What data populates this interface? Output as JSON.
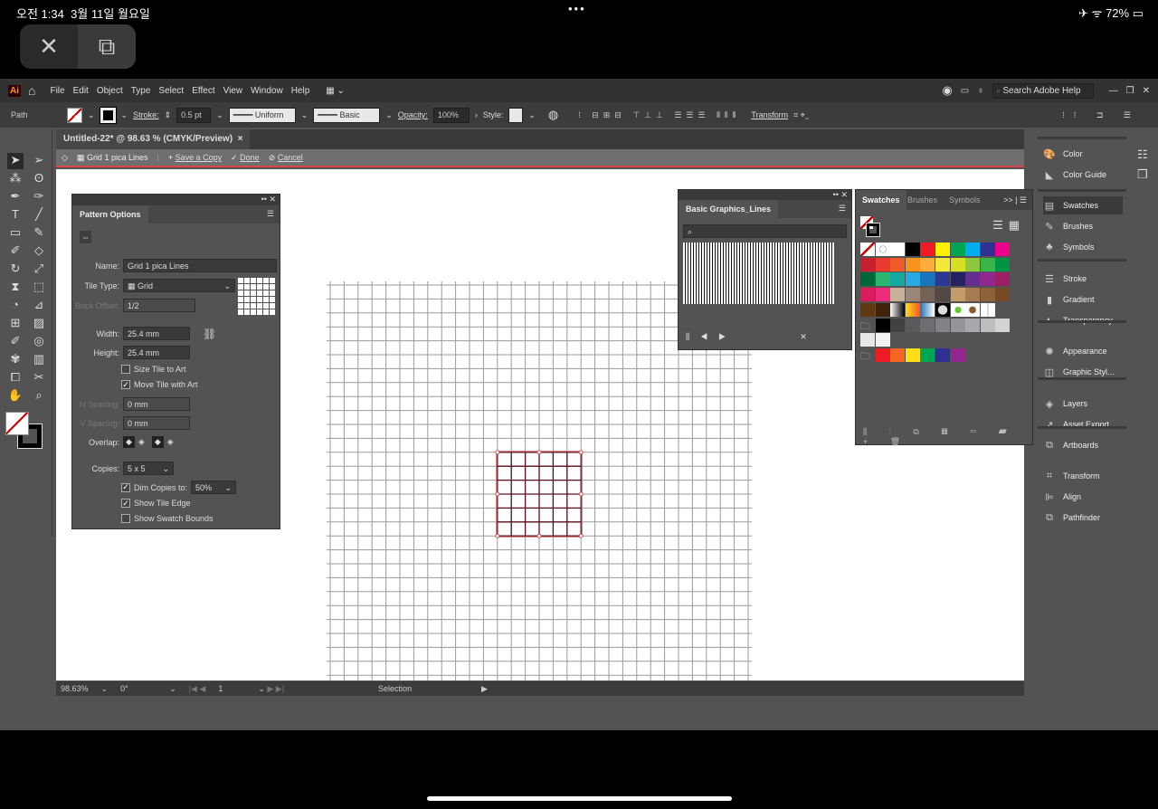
{
  "device": {
    "time": "오전 1:34",
    "date": "3월 11일 월요일",
    "dots": "•••",
    "battery": "72%",
    "icons": [
      "airplane-icon",
      "wifi-icon",
      "battery-icon"
    ]
  },
  "overlay": {
    "close": "✕",
    "pip": "⧉"
  },
  "menu": [
    "File",
    "Edit",
    "Object",
    "Type",
    "Select",
    "Effect",
    "View",
    "Window",
    "Help"
  ],
  "search_placeholder": "Search Adobe Help",
  "control": {
    "selection": "Path",
    "stroke_label": "Stroke:",
    "stroke_value": "0.5 pt",
    "profile": "Uniform",
    "brush": "Basic",
    "opacity_label": "Opacity:",
    "opacity_value": "100%",
    "style_label": "Style:",
    "transform": "Transform"
  },
  "document_tab": {
    "title": "Untitled-22* @ 98.63 % (CMYK/Preview)",
    "close": "×"
  },
  "pattern_bar": {
    "name": "Grid 1 pica Lines",
    "save": "Save a Copy",
    "done": "Done",
    "cancel": "Cancel"
  },
  "pattern_options": {
    "title": "Pattern Options",
    "name_label": "Name:",
    "name_value": "Grid 1 pica Lines",
    "tile_type_label": "Tile Type:",
    "tile_type_value": "Grid",
    "brick_offset_label": "Brick Offset:",
    "brick_offset_value": "1/2",
    "width_label": "Width:",
    "width_value": "25.4 mm",
    "height_label": "Height:",
    "height_value": "25.4 mm",
    "size_tile": "Size Tile to Art",
    "size_tile_checked": false,
    "move_tile": "Move Tile with Art",
    "move_tile_checked": true,
    "h_spacing_label": "H Spacing:",
    "h_spacing_value": "0 mm",
    "v_spacing_label": "V Spacing:",
    "v_spacing_value": "0 mm",
    "overlap_label": "Overlap:",
    "copies_label": "Copies:",
    "copies_value": "5 x 5",
    "dim_copies": "Dim Copies to:",
    "dim_copies_checked": true,
    "dim_value": "50%",
    "show_tile_edge": "Show Tile Edge",
    "show_tile_edge_checked": true,
    "show_swatch_bounds": "Show Swatch Bounds",
    "show_swatch_bounds_checked": false
  },
  "graphics_panel": {
    "title": "Basic Graphics_Lines"
  },
  "swatches_panel": {
    "tabs": [
      "Swatches",
      "Brushes",
      "Symbols"
    ],
    "rows": [
      [
        "none",
        "reg",
        "#ffffff",
        "#000000",
        "#ed1c24",
        "#fff200",
        "#00a651",
        "#00aeef",
        "#2e3192",
        "#ec008c"
      ],
      [
        "#c8202f",
        "#e8392e",
        "#f15a29",
        "#f7941d",
        "#fbae3c",
        "#f5e83a",
        "#d7df23",
        "#8dc63f",
        "#39b54a",
        "#009444"
      ],
      [
        "#006838",
        "#2bb673",
        "#14a89e",
        "#27aae1",
        "#1c75bc",
        "#2b3990",
        "#262262",
        "#662d91",
        "#92278f",
        "#9e1f63"
      ],
      [
        "#da1c5c",
        "#ee2a7b",
        "#c7b299",
        "#998675",
        "#736357",
        "#534741",
        "#c69c6d",
        "#a67c52",
        "#8c6239",
        "#754c24"
      ],
      [
        "#603913",
        "#42210b",
        "grad-bw",
        "grad-yo",
        "grad-blue",
        "pat-dot",
        "pat-green",
        "pat-brown",
        "pat-grid"
      ],
      [
        "folder",
        "#000000",
        "#414042",
        "#58595b",
        "#6d6e71",
        "#808285",
        "#939598",
        "#a7a9ac",
        "#bcbec0",
        "#d1d3d4"
      ],
      [
        "#e6e7e8",
        "#f1f2f2"
      ],
      [
        "folder",
        "#ed1c24",
        "#f26522",
        "#ffde17",
        "#00a651",
        "#2e3192",
        "#92278f"
      ]
    ]
  },
  "right_dock": [
    "Color",
    "Color Guide",
    "Swatches",
    "Brushes",
    "Symbols",
    "Stroke",
    "Gradient",
    "Transparency",
    "Appearance",
    "Graphic Styl...",
    "Layers",
    "Asset Export",
    "Artboards",
    "Transform",
    "Align",
    "Pathfinder"
  ],
  "statusbar": {
    "zoom": "98.63%",
    "rotation": "0°",
    "artboard": "1",
    "tool": "Selection"
  }
}
